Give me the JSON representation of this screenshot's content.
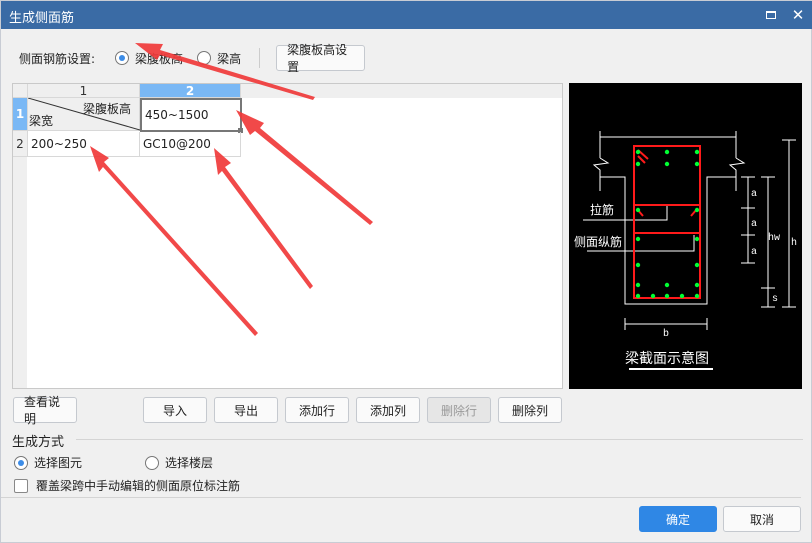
{
  "window": {
    "title": "生成侧面筋",
    "maximize_icon": "maximize-icon",
    "close_icon": "close-icon",
    "close_glyph": "✕"
  },
  "settings": {
    "label": "侧面钢筋设置:",
    "options": [
      {
        "label": "梁腹板高",
        "selected": true
      },
      {
        "label": "梁高",
        "selected": false
      }
    ],
    "config_button": "梁腹板高设置"
  },
  "grid": {
    "col_headers": [
      "1",
      "2"
    ],
    "row_headers": [
      "1",
      "2"
    ],
    "selected_col": 2,
    "selected_row": 1,
    "corner_top_label": "梁腹板高",
    "corner_bottom_label": "梁宽",
    "rows": [
      [
        "",
        "450~1500"
      ],
      [
        "200~250",
        "GC10@200"
      ]
    ]
  },
  "preview": {
    "caption": "梁截面示意图",
    "labels": {
      "tie_bar": "拉筋",
      "side_bar": "侧面纵筋",
      "a": "a",
      "hw": "hw",
      "h": "h",
      "s": "s",
      "b": "b"
    },
    "colors": {
      "stirrup": "#ff1a1a",
      "rebar": "#00ff33",
      "line": "#ffffff",
      "bg": "#000000"
    }
  },
  "actions": {
    "help": "查看说明",
    "import": "导入",
    "export": "导出",
    "add_row": "添加行",
    "add_col": "添加列",
    "delete_row": "删除行",
    "delete_col": "删除列",
    "delete_row_disabled": true
  },
  "generation": {
    "group_label": "生成方式",
    "options": [
      {
        "label": "选择图元",
        "selected": true
      },
      {
        "label": "选择楼层",
        "selected": false
      }
    ],
    "override_checkbox": {
      "label": "覆盖梁跨中手动编辑的侧面原位标注筋",
      "checked": false
    }
  },
  "footer": {
    "ok": "确定",
    "cancel": "取消"
  },
  "colors": {
    "titlebar": "#3a6ba5",
    "accent": "#2f87e5",
    "selected_header": "#7ab8f5",
    "annotation_arrow": "#f03a3a"
  }
}
